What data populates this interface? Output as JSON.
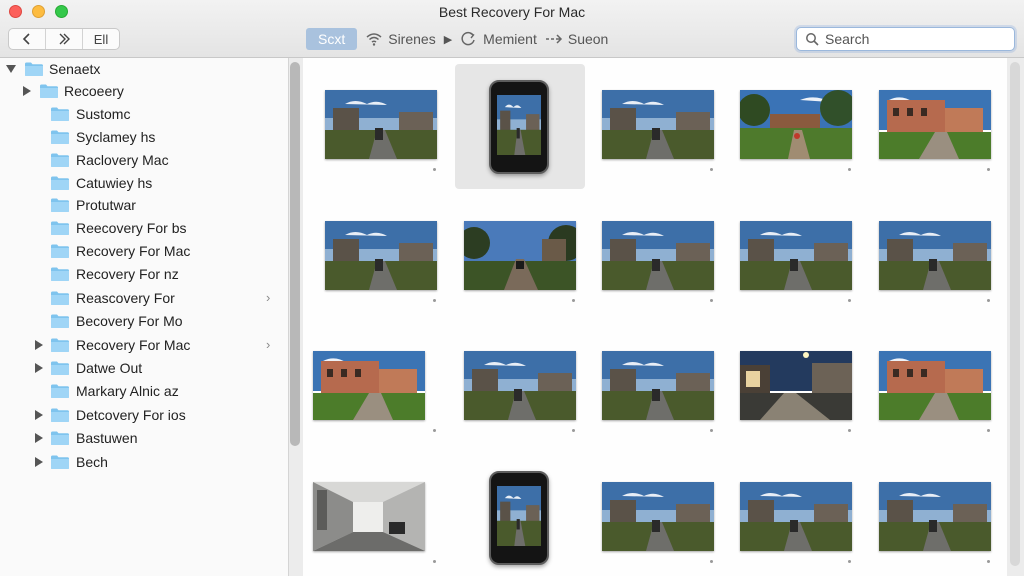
{
  "window": {
    "title": "Best Recovery For Mac"
  },
  "toolbar": {
    "back_icon": "chevron-left-icon",
    "forward_icon": "double-chevron-right-icon",
    "view_label": "Ell",
    "path": [
      {
        "label": "Scxt",
        "icon": "",
        "selected": true
      },
      {
        "label": "Sirenes",
        "icon": "wifi-icon",
        "selected": false
      },
      {
        "label": "Memient",
        "icon": "refresh-icon",
        "selected": false
      },
      {
        "label": "Sueon",
        "icon": "arrow-right-icon",
        "selected": false
      }
    ]
  },
  "search": {
    "placeholder": "Search",
    "value": ""
  },
  "sidebar": {
    "items": [
      {
        "label": "Senaetx",
        "level": 0,
        "disclosure": "down",
        "chevron": false
      },
      {
        "label": "Recoeery",
        "level": 1,
        "disclosure": "right",
        "chevron": false
      },
      {
        "label": "Sustomc",
        "level": 2,
        "disclosure": "none",
        "chevron": false
      },
      {
        "label": "Syclamey hs",
        "level": 2,
        "disclosure": "none",
        "chevron": false
      },
      {
        "label": "Raclovery Mac",
        "level": 2,
        "disclosure": "none",
        "chevron": false
      },
      {
        "label": "Catuwiey hs",
        "level": 2,
        "disclosure": "none",
        "chevron": false
      },
      {
        "label": "Protutwar",
        "level": 2,
        "disclosure": "none",
        "chevron": false
      },
      {
        "label": "Reecovery For bs",
        "level": 2,
        "disclosure": "none",
        "chevron": false
      },
      {
        "label": "Recovery For Mac",
        "level": 2,
        "disclosure": "none",
        "chevron": false
      },
      {
        "label": "Recovery For nz",
        "level": 2,
        "disclosure": "none",
        "chevron": false
      },
      {
        "label": "Reascovery For",
        "level": 2,
        "disclosure": "none",
        "chevron": true
      },
      {
        "label": "Becovery For Mo",
        "level": 2,
        "disclosure": "none",
        "chevron": false
      },
      {
        "label": "Recovery For Mac",
        "level": 2,
        "disclosure": "right",
        "chevron": true
      },
      {
        "label": "Datwe Out",
        "level": 2,
        "disclosure": "right",
        "chevron": false
      },
      {
        "label": "Markary Alnic az",
        "level": 2,
        "disclosure": "none",
        "chevron": false
      },
      {
        "label": "Detcovery For ios",
        "level": 2,
        "disclosure": "right",
        "chevron": false
      },
      {
        "label": "Bastuwen",
        "level": 2,
        "disclosure": "right",
        "chevron": false
      },
      {
        "label": "Bech",
        "level": 2,
        "disclosure": "right",
        "chevron": false
      }
    ]
  },
  "grid": {
    "items": [
      {
        "kind": "photo",
        "scene": "road"
      },
      {
        "kind": "phone",
        "scene": "road",
        "selected": true
      },
      {
        "kind": "photo",
        "scene": "road"
      },
      {
        "kind": "photo",
        "scene": "garden"
      },
      {
        "kind": "photo",
        "scene": "villa"
      },
      {
        "kind": "photo",
        "scene": "road"
      },
      {
        "kind": "photo",
        "scene": "dusk"
      },
      {
        "kind": "photo",
        "scene": "road"
      },
      {
        "kind": "photo",
        "scene": "road"
      },
      {
        "kind": "photo",
        "scene": "road"
      },
      {
        "kind": "photo",
        "scene": "villa"
      },
      {
        "kind": "photo",
        "scene": "road"
      },
      {
        "kind": "photo",
        "scene": "road"
      },
      {
        "kind": "photo",
        "scene": "night"
      },
      {
        "kind": "photo",
        "scene": "villa"
      },
      {
        "kind": "photo",
        "scene": "interior"
      },
      {
        "kind": "phone",
        "scene": "road",
        "selected": false
      },
      {
        "kind": "photo",
        "scene": "road"
      },
      {
        "kind": "photo",
        "scene": "road"
      },
      {
        "kind": "photo",
        "scene": "road"
      }
    ]
  }
}
